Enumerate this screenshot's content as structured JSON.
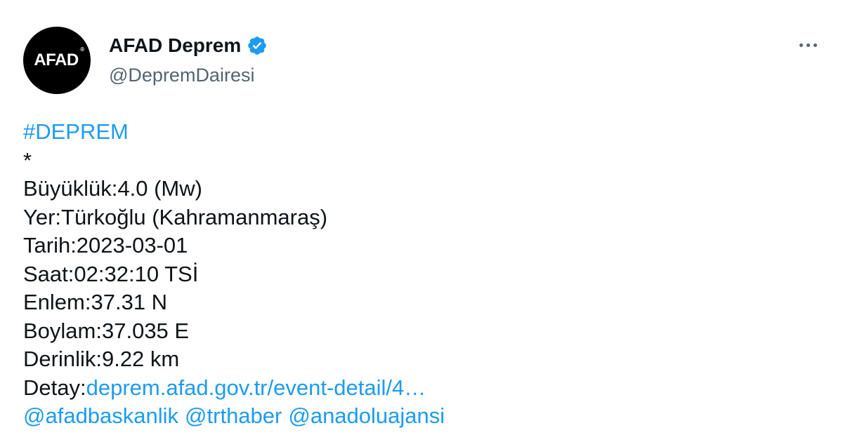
{
  "author": {
    "avatar_text": "AFAD",
    "avatar_mark": "®",
    "display_name": "AFAD Deprem",
    "handle": "@DepremDairesi",
    "verified_icon": "verified-badge-icon",
    "verified_color": "#1d9bf0"
  },
  "menu": {
    "icon": "more-options-icon"
  },
  "tweet": {
    "hashtag": "#DEPREM",
    "separator": "*",
    "magnitude": "Büyüklük:4.0 (Mw)",
    "location": "Yer:Türkoğlu (Kahramanmaraş)",
    "date": "Tarih:2023-03-01",
    "time": "Saat:02:32:10 TSİ",
    "latitude": "Enlem:37.31 N",
    "longitude": "Boylam:37.035 E",
    "depth": "Derinlik:9.22 km",
    "detail_label": "Detay:",
    "detail_link": "deprem.afad.gov.tr/event-detail/4…",
    "mentions": [
      "@afadbaskanlik",
      "@trthaber",
      "@anadoluajansi"
    ]
  },
  "colors": {
    "link": "#1d9bf0",
    "text": "#0f1419",
    "secondary": "#536471",
    "avatar_bg": "#000000"
  }
}
